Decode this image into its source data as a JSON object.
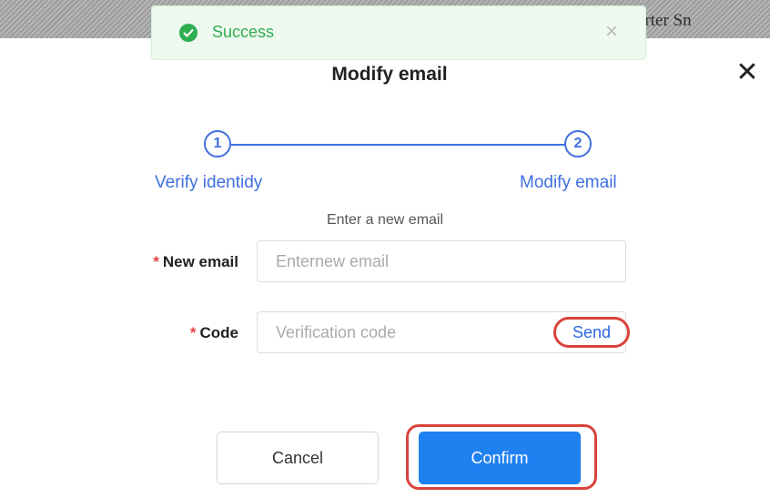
{
  "backdrop": {
    "text": "erter Sn"
  },
  "toast": {
    "message": "Success",
    "close_glyph": "×",
    "icon": "check-circle-icon",
    "color": "#2fae52"
  },
  "modal": {
    "title": "Modify email",
    "close_glyph": "✕"
  },
  "steps": [
    {
      "number": "1",
      "label": "Verify identidy"
    },
    {
      "number": "2",
      "label": "Modify email"
    }
  ],
  "subtitle": "Enter a new email",
  "form": {
    "email_label": "New email",
    "email_placeholder": "Enternew email",
    "code_label": "Code",
    "code_placeholder": "Verification code",
    "required_mark": "*",
    "send_label": "Send"
  },
  "buttons": {
    "cancel": "Cancel",
    "confirm": "Confirm"
  },
  "colors": {
    "accent": "#3f6fe0",
    "primary": "#1f80f0",
    "highlight": "#d9433c"
  }
}
